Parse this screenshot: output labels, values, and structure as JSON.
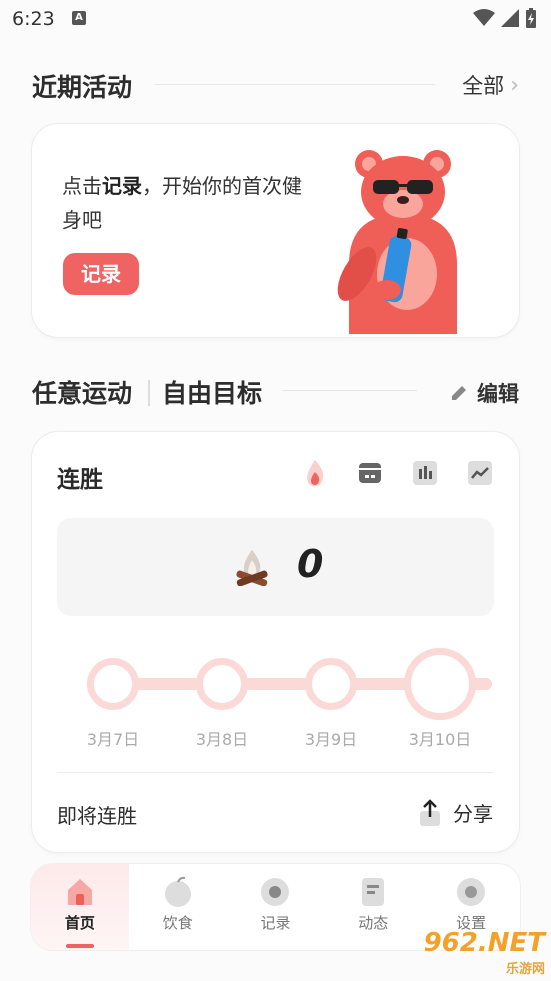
{
  "status_bar": {
    "time": "6:23",
    "notif_icon": "A"
  },
  "recent": {
    "title": "近期活动",
    "all_label": "全部",
    "prompt_prefix": "点击",
    "prompt_bold": "记录",
    "prompt_suffix": "，开始你的首次健身吧",
    "record_button": "记录"
  },
  "tabs": {
    "any": "任意运动",
    "free": "自由目标",
    "edit": "编辑"
  },
  "streak": {
    "title": "连胜",
    "value": "0",
    "dates": [
      "3月7日",
      "3月8日",
      "3月9日",
      "3月10日"
    ],
    "footer_label": "即将连胜",
    "share_label": "分享"
  },
  "nav": {
    "items": [
      {
        "label": "首页",
        "icon": "home-icon"
      },
      {
        "label": "饮食",
        "icon": "apple-icon"
      },
      {
        "label": "记录",
        "icon": "record-icon"
      },
      {
        "label": "动态",
        "icon": "feed-icon"
      },
      {
        "label": "设置",
        "icon": "gear-icon"
      }
    ],
    "active": 0
  },
  "watermark": {
    "brand": "962.NET",
    "sub": "乐游网"
  },
  "colors": {
    "accent": "#f06363",
    "track": "#fbd9d6"
  }
}
